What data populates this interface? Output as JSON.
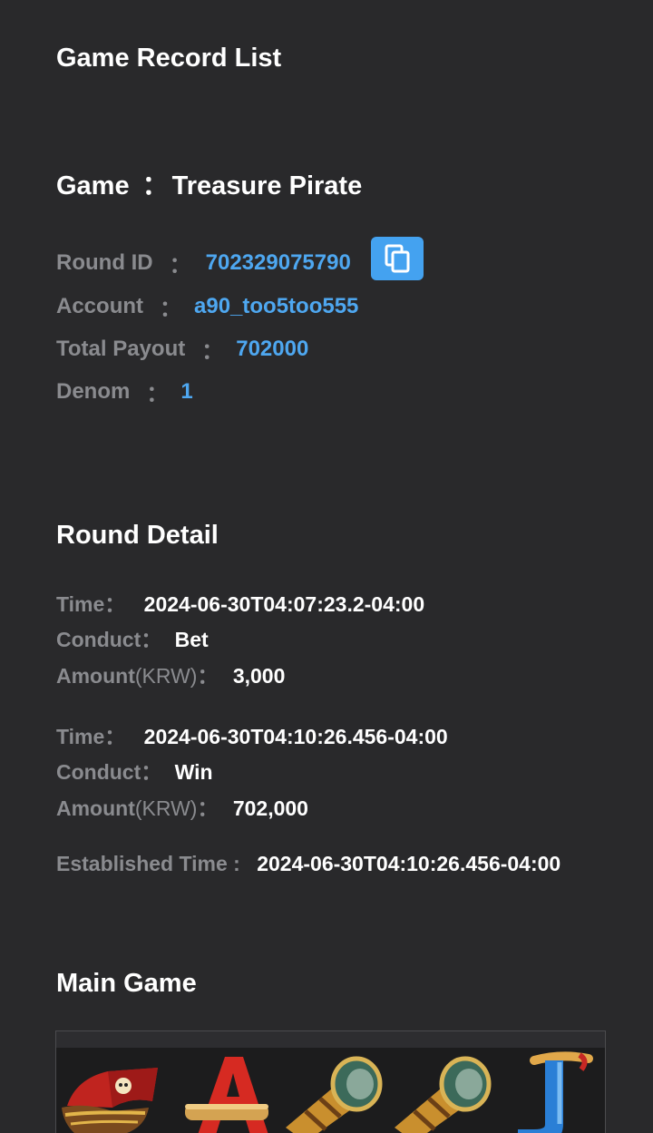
{
  "header": {
    "title": "Game Record List"
  },
  "game": {
    "label": "Game",
    "colon": "：",
    "name": "Treasure Pirate"
  },
  "info": {
    "round_id": {
      "label": "Round ID",
      "colon": "：",
      "value": "702329075790"
    },
    "account": {
      "label": "Account",
      "colon": "：",
      "value": "a90_too5too555"
    },
    "total_payout": {
      "label": "Total Payout",
      "colon": "：",
      "value": "702000"
    },
    "denom": {
      "label": "Denom",
      "colon": "：",
      "value": "1"
    },
    "copy_icon": "copy-icon"
  },
  "round_detail": {
    "title": "Round Detail",
    "records": [
      {
        "time_label": "Time",
        "time_value": "2024-06-30T04:07:23.2-04:00",
        "conduct_label": "Conduct",
        "conduct_value": "Bet",
        "amount_label": "Amount",
        "amount_unit": "(KRW)",
        "amount_value": "3,000"
      },
      {
        "time_label": "Time",
        "time_value": "2024-06-30T04:10:26.456-04:00",
        "conduct_label": "Conduct",
        "conduct_value": "Win",
        "amount_label": "Amount",
        "amount_unit": "(KRW)",
        "amount_value": "702,000"
      }
    ],
    "colon": "：",
    "established_label": "Established Time :",
    "established_value": "2024-06-30T04:10:26.456-04:00"
  },
  "main_game": {
    "title": "Main Game",
    "symbols": [
      "pirate-ship-symbol",
      "letter-a-symbol",
      "spyglass-symbol",
      "spyglass-symbol",
      "letter-j-symbol"
    ]
  },
  "colors": {
    "background": "#29292b",
    "label_gray": "#8a8b8f",
    "link_blue": "#4ea7f0",
    "button_blue": "#44a2f0"
  }
}
